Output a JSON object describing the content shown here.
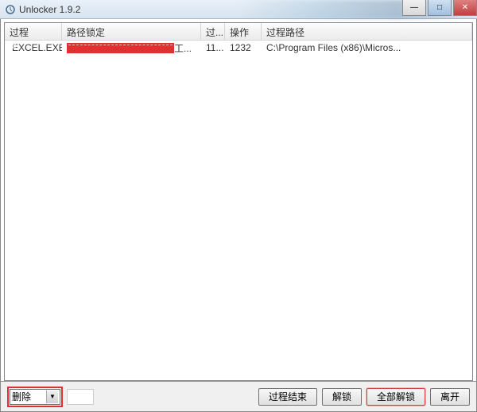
{
  "window": {
    "title": "Unlocker 1.9.2"
  },
  "columns": {
    "process": "过程",
    "path_lock": "路径锁定",
    "pid": "过...",
    "action": "操作",
    "proc_path": "过程路径"
  },
  "rows": [
    {
      "process": "EXCEL.EXE",
      "path_lock_suffix": "工...",
      "pid": "11...",
      "action": "1232",
      "proc_path": "C:\\Program Files (x86)\\Micros..."
    }
  ],
  "bottom": {
    "action_selected": "删除",
    "end_process": "过程结束",
    "unlock": "解锁",
    "unlock_all": "全部解锁",
    "leave": "离开"
  }
}
